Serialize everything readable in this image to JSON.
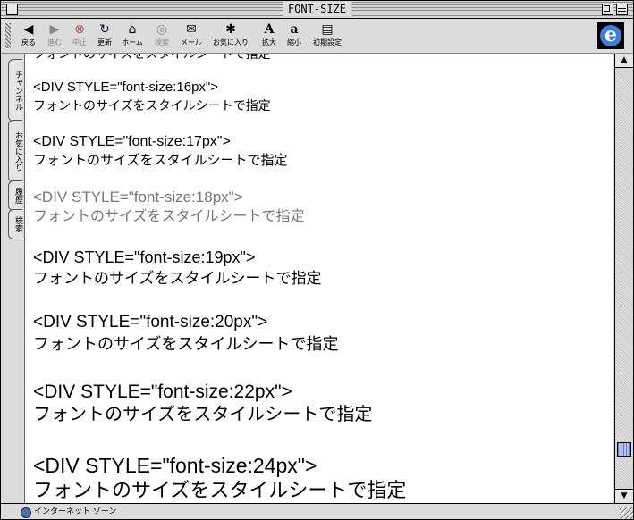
{
  "window": {
    "title": "FONT-SIZE"
  },
  "toolbar": {
    "buttons": [
      {
        "label": "戻る",
        "icon": "◀"
      },
      {
        "label": "進む",
        "icon": "▶"
      },
      {
        "label": "中止",
        "icon": "⊗"
      },
      {
        "label": "更新",
        "icon": "↻"
      },
      {
        "label": "ホーム",
        "icon": "⌂"
      },
      {
        "label": "検索",
        "icon": "◎"
      },
      {
        "label": "メール",
        "icon": "✉"
      },
      {
        "label": "お気に入り",
        "icon": "✱"
      },
      {
        "label": "拡大",
        "icon": "A"
      },
      {
        "label": "縮小",
        "icon": "a"
      },
      {
        "label": "初期設定",
        "icon": "▤"
      }
    ],
    "logo": "e"
  },
  "sidetabs": [
    "チャンネル",
    "お気に入り",
    "履歴",
    "検索"
  ],
  "content": {
    "partial_line": "フォントのサイズをスタイルシートで指定",
    "blocks": [
      {
        "code": "<DIV STYLE=\"font-size:16px\">",
        "text": "フォントのサイズをスタイルシートで指定"
      },
      {
        "code": "<DIV STYLE=\"font-size:17px\">",
        "text": "フォントのサイズをスタイルシートで指定"
      },
      {
        "code": "<DIV STYLE=\"font-size:18px\">",
        "text": "フォントのサイズをスタイルシートで指定"
      },
      {
        "code": "<DIV STYLE=\"font-size:19px\">",
        "text": "フォントのサイズをスタイルシートで指定"
      },
      {
        "code": "<DIV STYLE=\"font-size:20px\">",
        "text": "フォントのサイズをスタイルシートで指定"
      },
      {
        "code": "<DIV STYLE=\"font-size:22px\">",
        "text": "フォントのサイズをスタイルシートで指定"
      },
      {
        "code": "<DIV STYLE=\"font-size:24px\">",
        "text": "フォントのサイズをスタイルシートで指定"
      }
    ]
  },
  "scrollbar": {
    "position_fraction": 0.92
  },
  "status": {
    "zone": "インターネット ゾーン"
  }
}
